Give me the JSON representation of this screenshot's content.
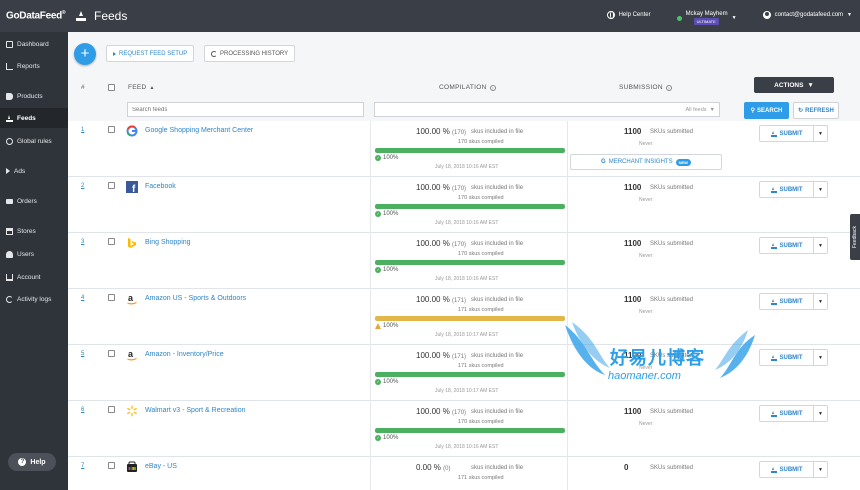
{
  "topbar": {
    "brand": "GoDataFeed",
    "brand_sup": "®",
    "page_title": "Feeds",
    "help_center": "Help Center",
    "user_name": "Mckay Mayhem",
    "plan_badge": "ULTIMATE",
    "user_email": "contact@godatafeed.com"
  },
  "sidebar": {
    "items": [
      {
        "label": "Dashboard",
        "icon": "dashboard-icon"
      },
      {
        "label": "Reports",
        "icon": "reports-icon"
      },
      {
        "label": "Products",
        "icon": "tag-icon"
      },
      {
        "label": "Feeds",
        "icon": "upload-icon",
        "active": true
      },
      {
        "label": "Global rules",
        "icon": "globe-icon"
      },
      {
        "label": "Ads",
        "icon": "megaphone-icon"
      },
      {
        "label": "Orders",
        "icon": "truck-icon"
      },
      {
        "label": "Stores",
        "icon": "store-icon"
      },
      {
        "label": "Users",
        "icon": "users-icon"
      },
      {
        "label": "Account",
        "icon": "bank-icon"
      },
      {
        "label": "Activity logs",
        "icon": "history-icon"
      }
    ],
    "help_label": "Help"
  },
  "toolbar": {
    "add_label": "+",
    "request_setup": "REQUEST FEED SETUP",
    "processing_history": "PROCESSING HISTORY",
    "actions": "ACTIONS"
  },
  "table": {
    "headers": {
      "num": "#",
      "feed": "FEED",
      "compilation": "COMPILATION",
      "submission": "SUBMISSION"
    },
    "search_placeholder": "Search feeds",
    "filter_value": "All feeds",
    "search_btn": "SEARCH",
    "refresh_btn": "REFRESH",
    "compiled_label": "skus included in file",
    "compiled_sub": "skus compiled",
    "submitted_label": "SKUs submitted",
    "never": "Never",
    "submit_label": "SUBMIT",
    "merchant_insights": "MERCHANT INSIGHTS",
    "new_badge": "NEW"
  },
  "rows": [
    {
      "num": "1",
      "name": "Google Shopping Merchant Center",
      "logo": "google-logo",
      "pct": "100.00 %",
      "count": "(170)",
      "compiled": "170",
      "progress": 100,
      "status": "ok",
      "status_label": "100%",
      "date": "July 18, 2018 10:16 AM EST",
      "submitted": "1100",
      "insights": true
    },
    {
      "num": "2",
      "name": "Facebook",
      "logo": "facebook-logo",
      "pct": "100.00 %",
      "count": "(170)",
      "compiled": "170",
      "progress": 100,
      "status": "ok",
      "status_label": "100%",
      "date": "July 18, 2018 10:16 AM EST",
      "submitted": "1100",
      "insights": false
    },
    {
      "num": "3",
      "name": "Bing Shopping",
      "logo": "bing-logo",
      "pct": "100.00 %",
      "count": "(170)",
      "compiled": "170",
      "progress": 100,
      "status": "ok",
      "status_label": "100%",
      "date": "July 18, 2018 10:16 AM EST",
      "submitted": "1100",
      "insights": false
    },
    {
      "num": "4",
      "name": "Amazon US - Sports & Outdoors",
      "logo": "amazon-logo",
      "pct": "100.00 %",
      "count": "(171)",
      "compiled": "171",
      "progress": 100,
      "status": "warn",
      "status_label": "100%",
      "date": "July 18, 2018 10:17 AM EST",
      "submitted": "1100",
      "insights": false
    },
    {
      "num": "5",
      "name": "Amazon - Inventory/Price",
      "logo": "amazon-logo",
      "pct": "100.00 %",
      "count": "(171)",
      "compiled": "171",
      "progress": 100,
      "status": "ok",
      "status_label": "100%",
      "date": "July 18, 2018 10:17 AM EST",
      "submitted": "1100",
      "insights": false
    },
    {
      "num": "6",
      "name": "Walmart v3 - Sport & Recreation",
      "logo": "walmart-logo",
      "pct": "100.00 %",
      "count": "(170)",
      "compiled": "170",
      "progress": 100,
      "status": "ok",
      "status_label": "100%",
      "date": "July 18, 2018 10:16 AM EST",
      "submitted": "1100",
      "insights": false
    },
    {
      "num": "7",
      "name": "eBay - US",
      "logo": "ebay-logo",
      "pct": "0.00 %",
      "count": "(0)",
      "compiled": "171",
      "progress": 0,
      "status": "ok",
      "status_label": "",
      "date": "",
      "submitted": "0",
      "insights": false
    }
  ],
  "feedback_label": "Feedback",
  "watermark": {
    "title": "好易儿博客",
    "url": "haomaner.com"
  },
  "colors": {
    "accent": "#2e9ce6",
    "sidebar": "#2f343b",
    "topbar": "#3a3f47",
    "success": "#4bb060",
    "warning": "#e2b648"
  }
}
